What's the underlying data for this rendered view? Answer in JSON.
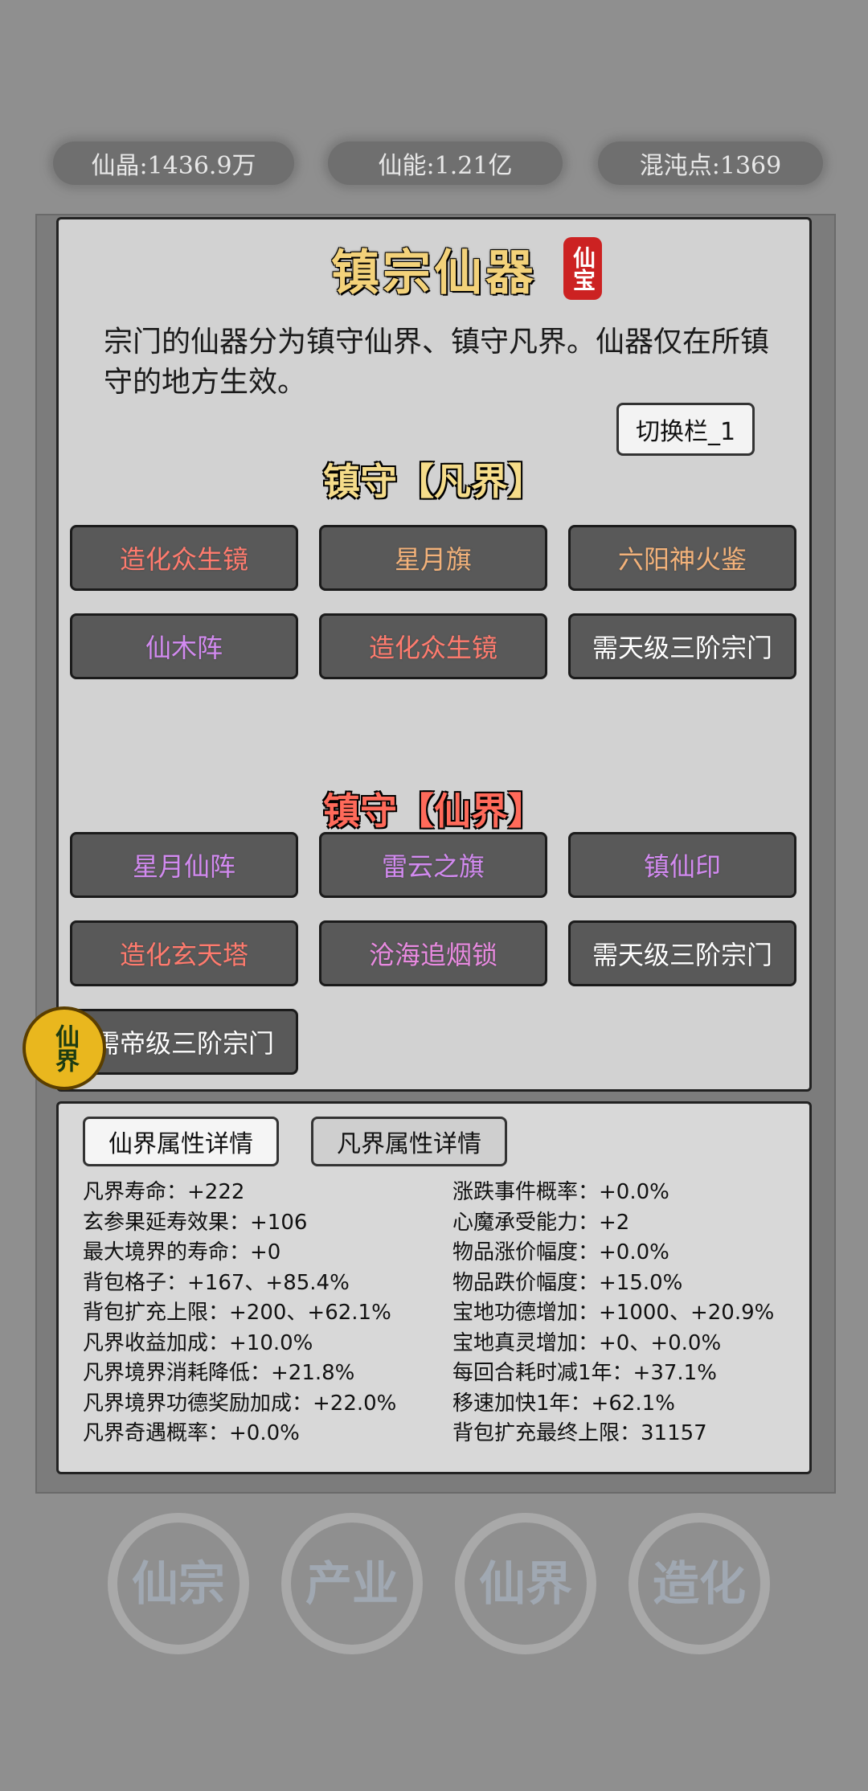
{
  "resources": {
    "crystal": "仙晶:1436.9万",
    "energy": "仙能:1.21亿",
    "chaos": "混沌点:1369"
  },
  "scroll": {
    "title": "镇宗仙器",
    "seal": "仙宝",
    "description": "宗门的仙器分为镇守仙界、镇守凡界。仙器仅在所镇守的地方生效。",
    "switch_label": "切换栏_1",
    "mortal_section": "镇守【凡界】",
    "immortal_section": "镇守【仙界】",
    "mortal_slots": [
      {
        "label": "造化众生镜",
        "color": "#ff7b6e"
      },
      {
        "label": "星月旗",
        "color": "#f3b27a"
      },
      {
        "label": "六阳神火鉴",
        "color": "#f3b27a"
      },
      {
        "label": "仙木阵",
        "color": "#d28af0"
      },
      {
        "label": "造化众生镜",
        "color": "#ff7b6e"
      },
      {
        "label": "需天级三阶宗门",
        "color": "#ffffff"
      }
    ],
    "immortal_slots": [
      {
        "label": "星月仙阵",
        "color": "#d28af0"
      },
      {
        "label": "雷云之旗",
        "color": "#d28af0"
      },
      {
        "label": "镇仙印",
        "color": "#d28af0"
      },
      {
        "label": "造化玄天塔",
        "color": "#ff7b6e"
      },
      {
        "label": "沧海追烟锁",
        "color": "#e88ae0"
      },
      {
        "label": "需天级三阶宗门",
        "color": "#ffffff"
      },
      {
        "label": "需帝级三阶宗门",
        "color": "#ffffff"
      }
    ]
  },
  "badge": "仙界",
  "details": {
    "tab_immortal": "仙界属性详情",
    "tab_mortal": "凡界属性详情",
    "left": [
      "凡界寿命：+222",
      "玄参果延寿效果：+106",
      "最大境界的寿命：+0",
      "背包格子：+167、+85.4%",
      "背包扩充上限：+200、+62.1%",
      "凡界收益加成：+10.0%",
      "凡界境界消耗降低：+21.8%",
      "凡界境界功德奖励加成：+22.0%",
      "凡界奇遇概率：+0.0%"
    ],
    "right": [
      "涨跌事件概率：+0.0%",
      "心魔承受能力：+2",
      "物品涨价幅度：+0.0%",
      "物品跌价幅度：+15.0%",
      "宝地功德增加：+1000、+20.9%",
      "宝地真灵增加：+0、+0.0%",
      "每回合耗时减1年：+37.1%",
      "移速加快1年：+62.1%",
      "背包扩充最终上限：31157"
    ]
  },
  "nav": [
    {
      "label": "仙宗"
    },
    {
      "label": "产业"
    },
    {
      "label": "仙界"
    },
    {
      "label": "造化"
    }
  ]
}
